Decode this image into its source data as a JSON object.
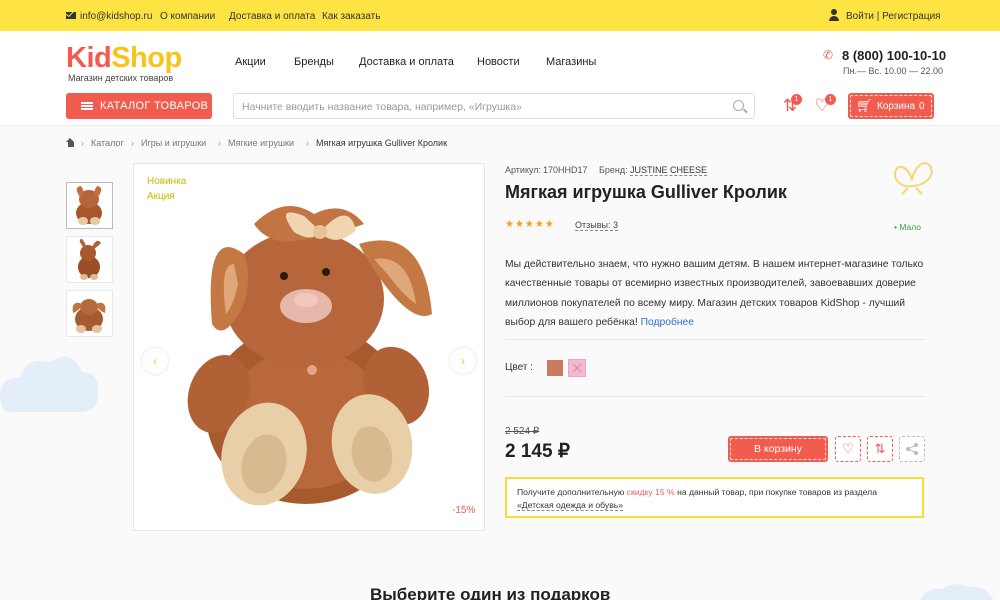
{
  "topbar": {
    "email": "info@kidshop.ru",
    "links": [
      "О компании",
      "Доставка и оплата",
      "Как заказать"
    ],
    "login": "Войти | Регистрация"
  },
  "header": {
    "logo_kid": "Kid",
    "logo_shop": "Shop",
    "logo_subtitle": "Магазин детских товаров",
    "nav": [
      "Акции",
      "Бренды",
      "Доставка и оплата",
      "Новости",
      "Магазины"
    ],
    "phone": "8 (800) 100-10-10",
    "hours": "Пн.— Вс. 10.00 — 22.00",
    "catalog_label": "КАТАЛОГ ТОВАРОВ",
    "search_placeholder": "Начните вводить название товара, например, «Игрушка»",
    "compare_count": "1",
    "favorites_count": "1",
    "cart_label": "Корзина",
    "cart_count": "0"
  },
  "breadcrumb": [
    "Каталог",
    "Игры и игрушки",
    "Мягкие игрушки",
    "Мягкая игрушка Gulliver Кролик"
  ],
  "gallery": {
    "tags": [
      "Новинка",
      "Акция"
    ],
    "discount": "-15%"
  },
  "product": {
    "article_label": "Артикул:",
    "article": "170HHD17",
    "brand_label": "Бренд:",
    "brand": "JUSTINE CHEESE",
    "title": "Мягкая игрушка Gulliver Кролик",
    "rating": 5,
    "stars": "★★★★★",
    "reviews": "Отзывы: 3",
    "stock": "• Мало",
    "description": "Мы действительно знаем, что нужно вашим детям. В нашем интернет-магазине только качественные товары от всемирно известных производителей, завоевавших доверие миллионов покупателей по всему миру. Магазин детских товаров KidShop - лучший выбор для вашего ребёнка!",
    "more_link": "Подробнее",
    "color_label": "Цвет :",
    "colors": [
      "#c97c5d",
      "#f4b9cf"
    ],
    "old_price": "2 524 ₽",
    "price": "2 145 ₽",
    "buy_label": "В корзину",
    "promo_text_1": "Получите дополнительную ",
    "promo_highlight": "скидку 15 %",
    "promo_text_2": " на данный товар, при покупке товаров из раздела",
    "promo_link": "«Детская одежда и обувь»"
  },
  "gifts": {
    "title": "Выберите один из подарков"
  },
  "colors": {
    "accent": "#f25c4f",
    "topbar": "#fde443",
    "logo_yellow": "#f8c31a"
  }
}
